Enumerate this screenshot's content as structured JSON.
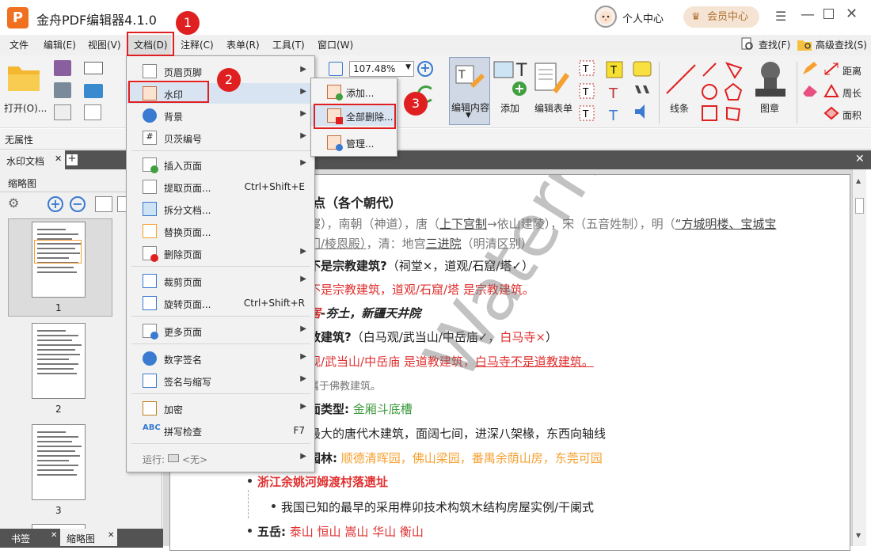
{
  "app": {
    "title": "金舟PDF编辑器4.1.0",
    "user_center": "个人中心",
    "member_center": "会员中心"
  },
  "menubar": [
    "文件",
    "编辑(E)",
    "视图(V)",
    "文档(D)",
    "注释(C)",
    "表单(R)",
    "工具(T)",
    "窗口(W)"
  ],
  "toolbar": {
    "open": "打开(O)...",
    "zoom": "107.48%",
    "edit_content": "编辑内容",
    "add": "添加",
    "edit_form": "编辑表单",
    "line": "线条",
    "stamp": "图章",
    "distance": "距离",
    "perimeter": "周长",
    "area": "面积",
    "find": "查找(F)",
    "adv_find": "高级查找(S)"
  },
  "properties": "无属性",
  "tabs": {
    "doc_tab": "水印文档",
    "thumbnails": "缩略图",
    "bookmark": "书签",
    "thumb_tab": "缩略图"
  },
  "thumbnails": [
    "1",
    "2",
    "3"
  ],
  "doc_menu": {
    "items": [
      {
        "label": "页眉页脚"
      },
      {
        "label": "水印"
      },
      {
        "label": "背景"
      },
      {
        "label": "贝茨编号"
      },
      {
        "label": "插入页面"
      },
      {
        "label": "提取页面...",
        "shortcut": "Ctrl+Shift+E"
      },
      {
        "label": "拆分文档..."
      },
      {
        "label": "替换页面..."
      },
      {
        "label": "删除页面"
      },
      {
        "label": "裁剪页面"
      },
      {
        "label": "旋转页面...",
        "shortcut": "Ctrl+Shift+R"
      },
      {
        "label": "更多页面"
      },
      {
        "label": "数字签名"
      },
      {
        "label": "签名与缩写"
      },
      {
        "label": "加密"
      },
      {
        "label": "拼写检查",
        "shortcut": "F7"
      }
    ],
    "run_label": "运行:",
    "run_value": "<无>"
  },
  "watermark_menu": {
    "add": "添加...",
    "delete_all": "全部删除...",
    "manage": "管理..."
  },
  "steps": [
    "1",
    "2",
    "3"
  ],
  "document": {
    "l1": "点（各个朝代）",
    "l2a": "寝），南朝（神道），唐（",
    "l2b": "上下宫制",
    "l2c": "→依山建陵），宋（五音姓制），明（",
    "l2d": "“方城明楼、宝城宝",
    "l3a": "门/棱恩殿）",
    "l3b": "，清：地宫",
    "l3c": "三进院",
    "l3d": "（明清区别）",
    "l4a": "不是宗教建筑?",
    "l4b": "（祠堂×，道观/石窟/塔✓）",
    "l5": "不是宗教建筑，道观/石窟/塔 是宗教建筑。",
    "l6a": "居",
    "l6b": "-夯土，新疆天井院",
    "l7a": "教建筑?",
    "l7b": "（白马观/武当山/中岳庙✓，",
    "l7c": "白马寺×",
    "l7d": "）",
    "l8a": "观/武当山/中岳庙 是道教建筑，",
    "l8b": "白马寺不是道教建筑。",
    "l9": "属于佛教建筑。",
    "l10a": "面类型:",
    "l10b": "金厢斗底槽",
    "l11": "最大的唐代木建筑，面阔七间，进深八架椽，东西向轴线",
    "l12a": "园林:",
    "l12b": "顺德清晖园，佛山梁园，番禺余荫山房，东莞可园",
    "l13": "浙江余姚河姆渡村落遗址",
    "l14": "我国已知的最早的采用榫卯技术构筑木结构房屋实例/干阑式",
    "l15a": "五岳:",
    "l15b": "泰山 恒山 嵩山 华山 衡山",
    "watermark": "Watermark Sample"
  },
  "colors": {
    "accent_red": "#e02020",
    "brand_orange": "#f07020",
    "text_red": "#e03030",
    "text_orange": "#f5a030",
    "text_green": "#3a9a3a"
  }
}
